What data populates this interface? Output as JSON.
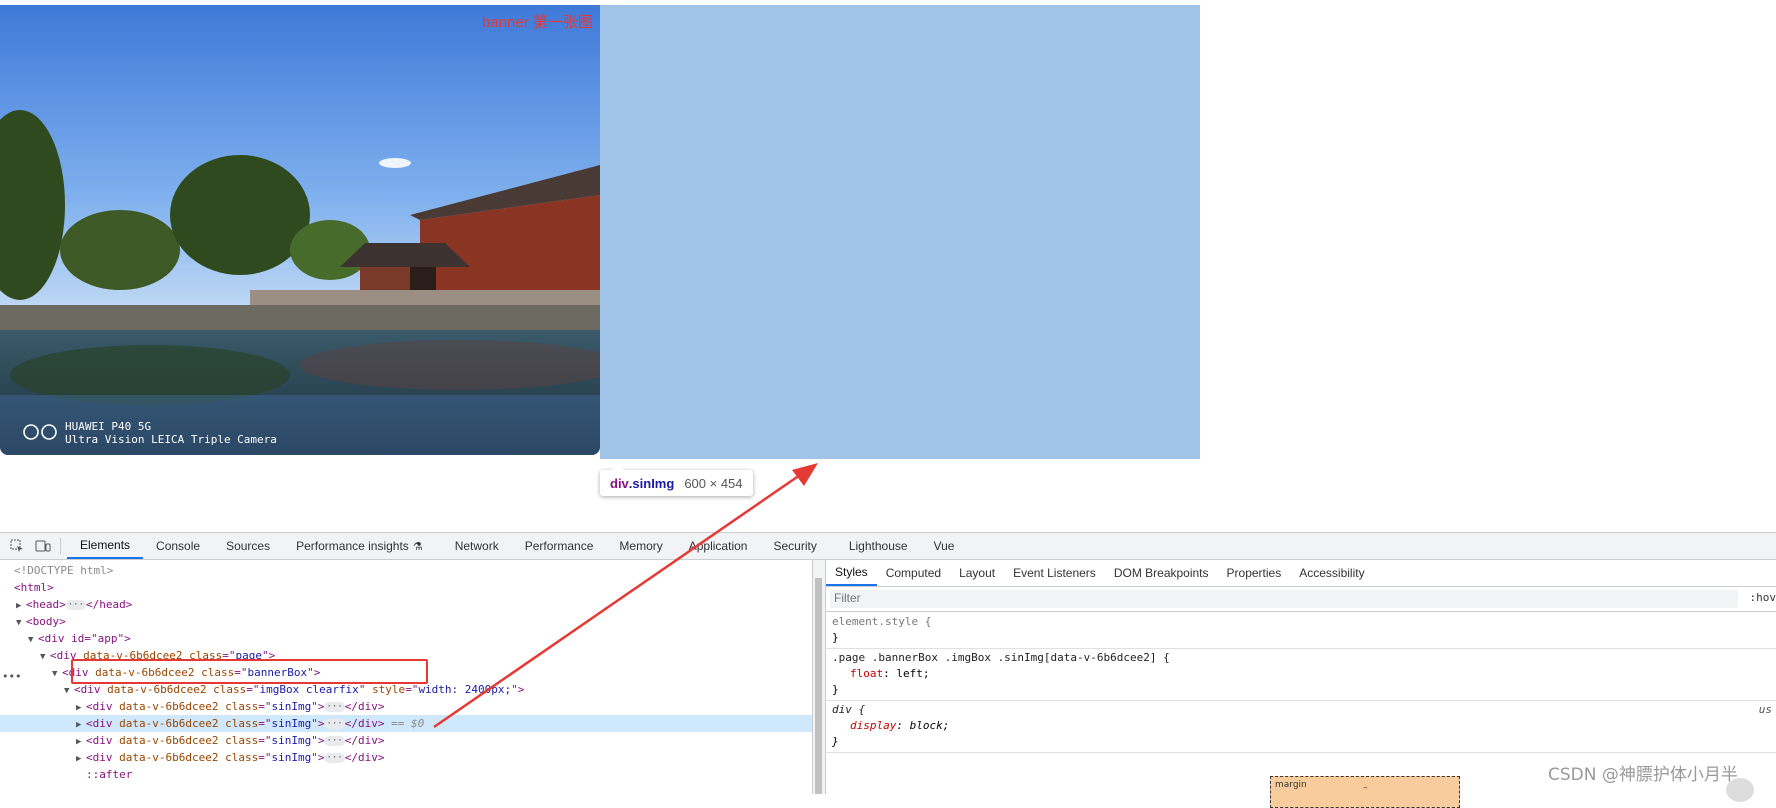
{
  "viewport": {
    "banner_label": "banner 第一张图",
    "camera_brand": "HUAWEI P40 5G",
    "camera_caption": "Ultra Vision LEICA Triple Camera"
  },
  "tooltip": {
    "element": "div",
    "class": ".sinImg",
    "size": "600 × 454"
  },
  "devtools": {
    "tabs": [
      "Elements",
      "Console",
      "Sources",
      "Performance insights",
      "Network",
      "Performance",
      "Memory",
      "Application",
      "Security",
      "Lighthouse",
      "Vue"
    ],
    "active_tab": "Elements",
    "dom": {
      "doctype": "<!DOCTYPE html>",
      "html_open": "<html>",
      "head": "<head>",
      "head_close": "</head>",
      "body_open": "<body>",
      "div_app": "<div id=\"app\">",
      "page": {
        "tag": "div",
        "data_attr": "data-v-6b6dcee2",
        "class": "page"
      },
      "bannerBox": {
        "tag": "div",
        "data_attr": "data-v-6b6dcee2",
        "class": "bannerBox"
      },
      "imgBox": {
        "tag": "div",
        "data_attr": "data-v-6b6dcee2",
        "class": "imgBox clearfix",
        "style": "width: 2400px;"
      },
      "sinImg_rows": [
        {
          "class": "sinImg",
          "selected": false
        },
        {
          "class": "sinImg",
          "selected": true
        },
        {
          "class": "sinImg",
          "selected": false
        },
        {
          "class": "sinImg",
          "selected": false
        }
      ],
      "close_div": "</div>",
      "selected_suffix": "== $0",
      "after": "::after"
    },
    "styles_tabs": [
      "Styles",
      "Computed",
      "Layout",
      "Event Listeners",
      "DOM Breakpoints",
      "Properties",
      "Accessibility"
    ],
    "active_styles_tab": "Styles",
    "filter_placeholder": "Filter",
    "hov_label": ":hov",
    "rules": [
      {
        "selector": "element.style {",
        "decls": [],
        "close": "}"
      },
      {
        "selector": ".page .bannerBox .imgBox .sinImg[data-v-6b6dcee2] {",
        "decls": [
          {
            "prop": "float",
            "value": "left;"
          }
        ],
        "close": "}"
      },
      {
        "selector": "div {",
        "decls": [
          {
            "prop": "display",
            "value": "block;"
          }
        ],
        "close": "}",
        "source": "us"
      }
    ],
    "boxmodel_label": "margin",
    "boxmodel_value": "–"
  },
  "watermark": "CSDN @神膘护体小月半",
  "colors": {
    "highlight": "#a0c4e8",
    "selection_box": "#e53935",
    "tag": "#881280",
    "attr": "#994500",
    "value": "#1a1aa6"
  }
}
